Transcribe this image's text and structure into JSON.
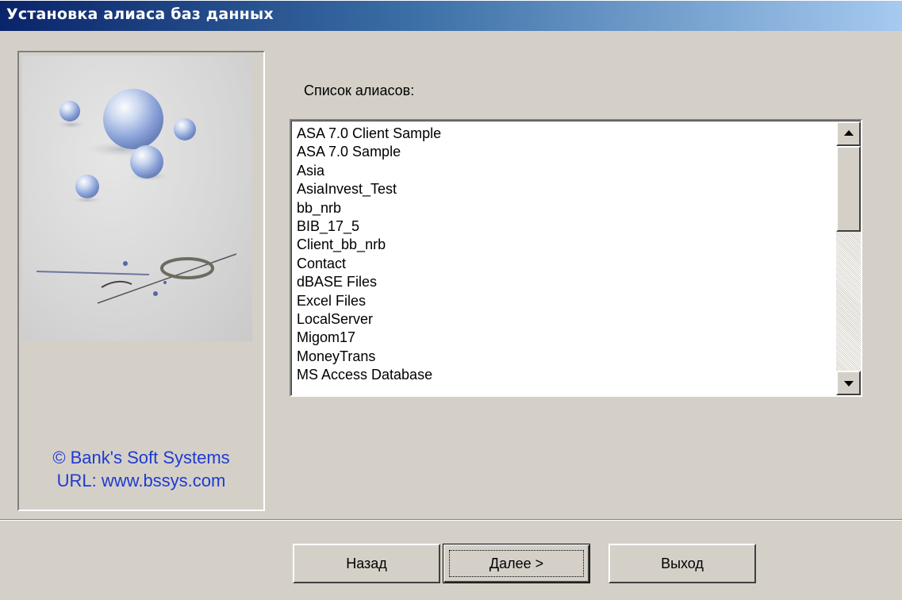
{
  "window": {
    "title": "Установка алиаса баз данных"
  },
  "left_panel": {
    "copyright_line1": "© Bank's Soft Systems",
    "copyright_line2": "URL:  www.bssys.com"
  },
  "aliases": {
    "label": "Список алиасов:",
    "items": [
      "ASA 7.0 Client Sample",
      "ASA 7.0 Sample",
      "Asia",
      "AsiaInvest_Test",
      "bb_nrb",
      "BIB_17_5",
      "Client_bb_nrb",
      "Contact",
      "dBASE Files",
      "Excel Files",
      "LocalServer",
      "Migom17",
      "MoneyTrans",
      "MS Access Database"
    ]
  },
  "buttons": {
    "back_label": "Назад",
    "next_label": "Далее >",
    "exit_label": "Выход"
  },
  "colors": {
    "title_gradient_start": "#0a246a",
    "title_gradient_end": "#a6caf0",
    "face": "#d4d0c8",
    "copyright_text": "#1f3ad0"
  }
}
